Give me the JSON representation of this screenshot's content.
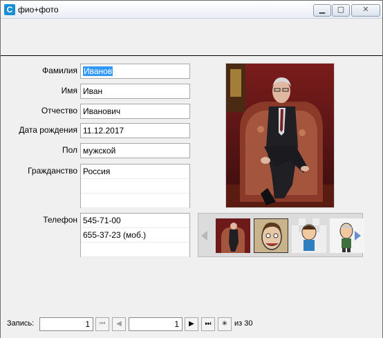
{
  "window": {
    "title": "фио+фото",
    "icon": "C",
    "controls": {
      "minimize": "▁",
      "maximize": "▢",
      "close": "✕"
    }
  },
  "form": {
    "fields": [
      {
        "name": "lastname",
        "label": "Фамилия",
        "value": "Иванов",
        "selected": true
      },
      {
        "name": "firstname",
        "label": "Имя",
        "value": "Иван"
      },
      {
        "name": "patronymic",
        "label": "Отчество",
        "value": "Иванович"
      },
      {
        "name": "birthdate",
        "label": "Дата рождения",
        "value": "11.12.2017"
      },
      {
        "name": "gender",
        "label": "Пол",
        "value": "мужской"
      }
    ],
    "citizenship": {
      "label": "Гражданство",
      "rows": [
        "Россия",
        "",
        ""
      ]
    },
    "phone": {
      "label": "Телефон",
      "rows": [
        "545-71-00",
        "655-37-23 (моб.)",
        ""
      ]
    }
  },
  "photo_strip": {
    "thumb_count": 4,
    "left_arrow": "scroll-left-icon",
    "right_arrow": "scroll-right-icon"
  },
  "navigator": {
    "label": "Запись:",
    "current_left": "1",
    "current_right": "1",
    "of_label": "из 30",
    "buttons": {
      "first": "⏮",
      "prev": "◀",
      "next": "▶",
      "last": "⏭",
      "new": "✳"
    }
  }
}
